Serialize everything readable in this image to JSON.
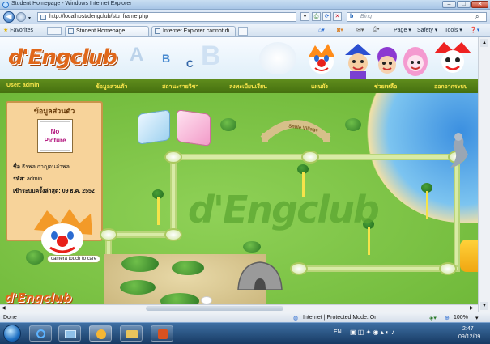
{
  "window": {
    "title": "Student Homepage - Windows Internet Explorer"
  },
  "address": {
    "url": "http://localhost/dengclub/stu_frame.php",
    "search_placeholder": "Bing"
  },
  "favorites_bar": {
    "favorites_label": "Favorites",
    "tabs": [
      "Student Homepage",
      "Internet Explorer cannot di..."
    ]
  },
  "command_bar": {
    "page_label": "Page ▾",
    "safety_label": "Safety ▾",
    "tools_label": "Tools ▾",
    "help_label": "❓▾"
  },
  "site": {
    "logo_text": "d'Engclub",
    "user_label": "User: admin",
    "menu": [
      "ข้อมูลส่วนตัว",
      "สถานะรายวิชา",
      "ลงทะเบียนเรียน",
      "แผนผัง",
      "ช่วยเหลือ",
      "ออกจากระบบ"
    ],
    "profile": {
      "heading": "ข้อมูลส่วนตัว",
      "no_picture": "No Picture",
      "name_label": "ชื่อ",
      "name_value": "ธีรพล กาญจนอำพล",
      "code_label": "รหัส:",
      "code_value": "admin",
      "last_login": "เข้าระบบครั้งล่าสุด: 09 ธ.ค. 2552"
    },
    "village_sign": "Smile Village",
    "camera_label": "camera touch to care",
    "big_logo": "d'Engclub",
    "footer_logo": "d'Engclub"
  },
  "status": {
    "done": "Done",
    "zone": "Internet | Protected Mode: On",
    "zoom": "100%"
  },
  "taskbar": {
    "lang": "EN",
    "time": "2:47",
    "date": "09/12/09"
  },
  "colors": {
    "grass": "#79c043",
    "path": "#d8eba6",
    "menu_text": "#ffe94d",
    "logo": "#e0671a"
  }
}
